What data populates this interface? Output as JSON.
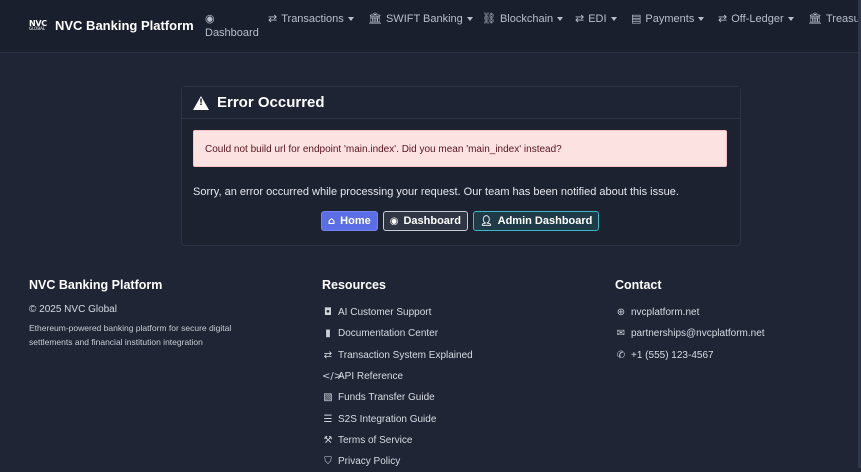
{
  "brand": {
    "logo_text": "NVC",
    "logo_sub": "GLOBAL",
    "name": "NVC Banking Platform"
  },
  "nav": {
    "dashboard": "Dashboard",
    "items": [
      {
        "label": "Transactions",
        "icon": "exchange-icon"
      },
      {
        "label": "SWIFT Banking",
        "icon": "bank-icon"
      },
      {
        "label": "Blockchain",
        "icon": "link-icon"
      },
      {
        "label": "EDI",
        "icon": "exchange-icon"
      },
      {
        "label": "Payments",
        "icon": "money-icon"
      },
      {
        "label": "Off-Ledger",
        "icon": "exchange-icon"
      },
      {
        "label": "Treasury",
        "icon": "bank-icon"
      }
    ]
  },
  "error": {
    "title": "Error Occurred",
    "alert": "Could not build url for endpoint 'main.index'. Did you mean 'main_index' instead?",
    "message": "Sorry, an error occurred while processing your request. Our team has been notified about this issue.",
    "buttons": {
      "home": "Home",
      "dashboard": "Dashboard",
      "admin": "Admin Dashboard"
    }
  },
  "footer": {
    "about": {
      "title": "NVC Banking Platform",
      "copyright": "© 2025 NVC Global",
      "description": "Ethereum-powered banking platform for secure digital settlements and financial institution integration"
    },
    "resources": {
      "title": "Resources",
      "links": [
        {
          "label": "AI Customer Support",
          "icon": "robot-icon"
        },
        {
          "label": "Documentation Center",
          "icon": "book-icon"
        },
        {
          "label": "Transaction System Explained",
          "icon": "exchange-icon"
        },
        {
          "label": "API Reference",
          "icon": "code-icon"
        },
        {
          "label": "Funds Transfer Guide",
          "icon": "file-pdf-icon"
        },
        {
          "label": "S2S Integration Guide",
          "icon": "server-icon"
        },
        {
          "label": "Terms of Service",
          "icon": "gavel-icon"
        },
        {
          "label": "Privacy Policy",
          "icon": "shield-icon"
        }
      ]
    },
    "contact": {
      "title": "Contact",
      "items": [
        {
          "label": "nvcplatform.net",
          "icon": "globe-icon"
        },
        {
          "label": "partnerships@nvcplatform.net",
          "icon": "envelope-icon"
        },
        {
          "label": "+1 (555) 123-4567",
          "icon": "phone-icon"
        }
      ]
    }
  }
}
